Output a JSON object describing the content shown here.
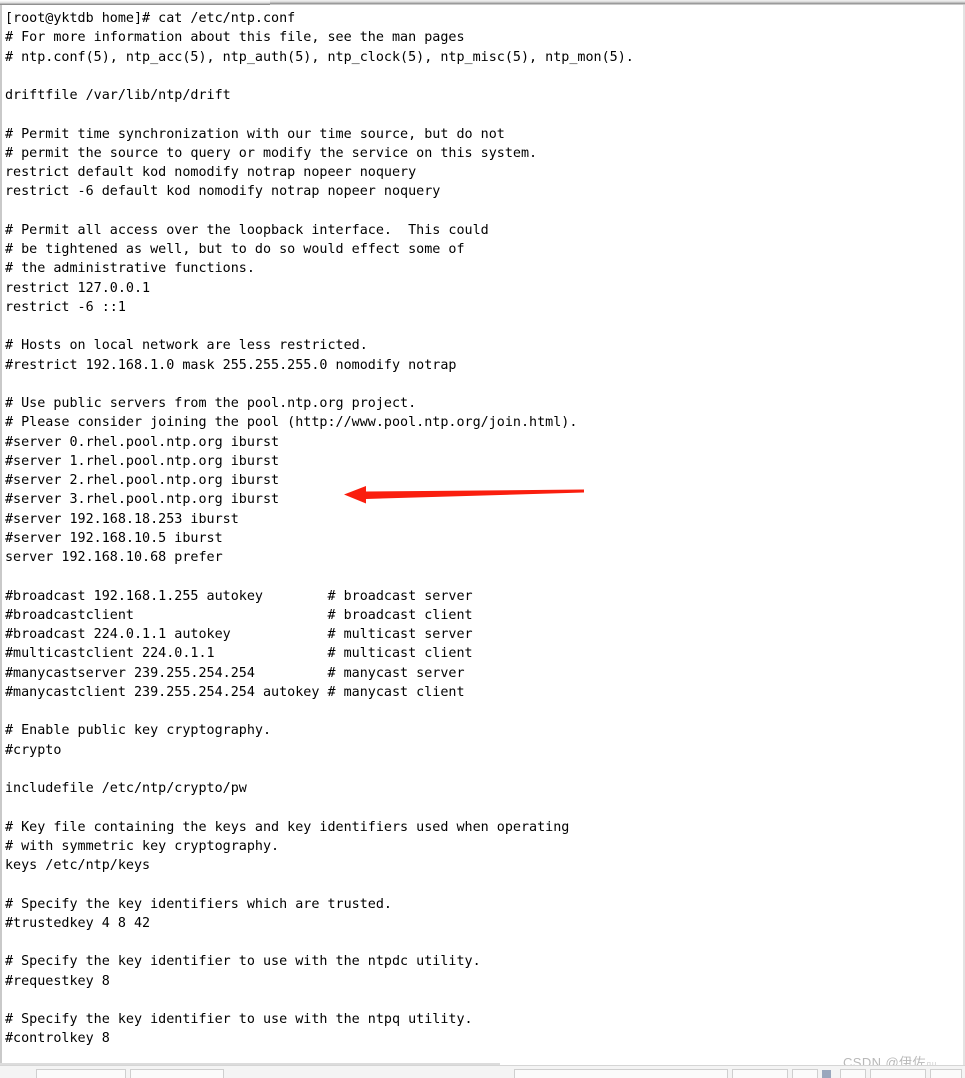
{
  "window": {
    "kind": "terminal-window",
    "background_color": "#ffffff",
    "text_color": "#000000"
  },
  "terminal": {
    "prompt_line": "[root@yktdb home]# cat /etc/ntp.conf",
    "command": "cat /etc/ntp.conf",
    "user": "root",
    "host": "yktdb",
    "cwd": "home",
    "file_shown": "/etc/ntp.conf",
    "lines": [
      "[root@yktdb home]# cat /etc/ntp.conf",
      "# For more information about this file, see the man pages",
      "# ntp.conf(5), ntp_acc(5), ntp_auth(5), ntp_clock(5), ntp_misc(5), ntp_mon(5).",
      "",
      "driftfile /var/lib/ntp/drift",
      "",
      "# Permit time synchronization with our time source, but do not",
      "# permit the source to query or modify the service on this system.",
      "restrict default kod nomodify notrap nopeer noquery",
      "restrict -6 default kod nomodify notrap nopeer noquery",
      "",
      "# Permit all access over the loopback interface.  This could",
      "# be tightened as well, but to do so would effect some of",
      "# the administrative functions.",
      "restrict 127.0.0.1",
      "restrict -6 ::1",
      "",
      "# Hosts on local network are less restricted.",
      "#restrict 192.168.1.0 mask 255.255.255.0 nomodify notrap",
      "",
      "# Use public servers from the pool.ntp.org project.",
      "# Please consider joining the pool (http://www.pool.ntp.org/join.html).",
      "#server 0.rhel.pool.ntp.org iburst",
      "#server 1.rhel.pool.ntp.org iburst",
      "#server 2.rhel.pool.ntp.org iburst",
      "#server 3.rhel.pool.ntp.org iburst",
      "#server 192.168.18.253 iburst",
      "#server 192.168.10.5 iburst",
      "server 192.168.10.68 prefer",
      "",
      "#broadcast 192.168.1.255 autokey        # broadcast server",
      "#broadcastclient                        # broadcast client",
      "#broadcast 224.0.1.1 autokey            # multicast server",
      "#multicastclient 224.0.1.1              # multicast client",
      "#manycastserver 239.255.254.254         # manycast server",
      "#manycastclient 239.255.254.254 autokey # manycast client",
      "",
      "# Enable public key cryptography.",
      "#crypto",
      "",
      "includefile /etc/ntp/crypto/pw",
      "",
      "# Key file containing the keys and key identifiers used when operating",
      "# with symmetric key cryptography.",
      "keys /etc/ntp/keys",
      "",
      "# Specify the key identifiers which are trusted.",
      "#trustedkey 4 8 42",
      "",
      "# Specify the key identifier to use with the ntpdc utility.",
      "#requestkey 8",
      "",
      "# Specify the key identifier to use with the ntpq utility.",
      "#controlkey 8"
    ]
  },
  "annotation": {
    "type": "arrow",
    "direction": "left",
    "color": "#fa1e0e",
    "points_at_line": "#server 3.rhel.pool.ntp.org iburst"
  },
  "watermark": {
    "text": "CSDN @伊佐",
    "tail": "лıʟ",
    "color": "#b8b8b8"
  }
}
